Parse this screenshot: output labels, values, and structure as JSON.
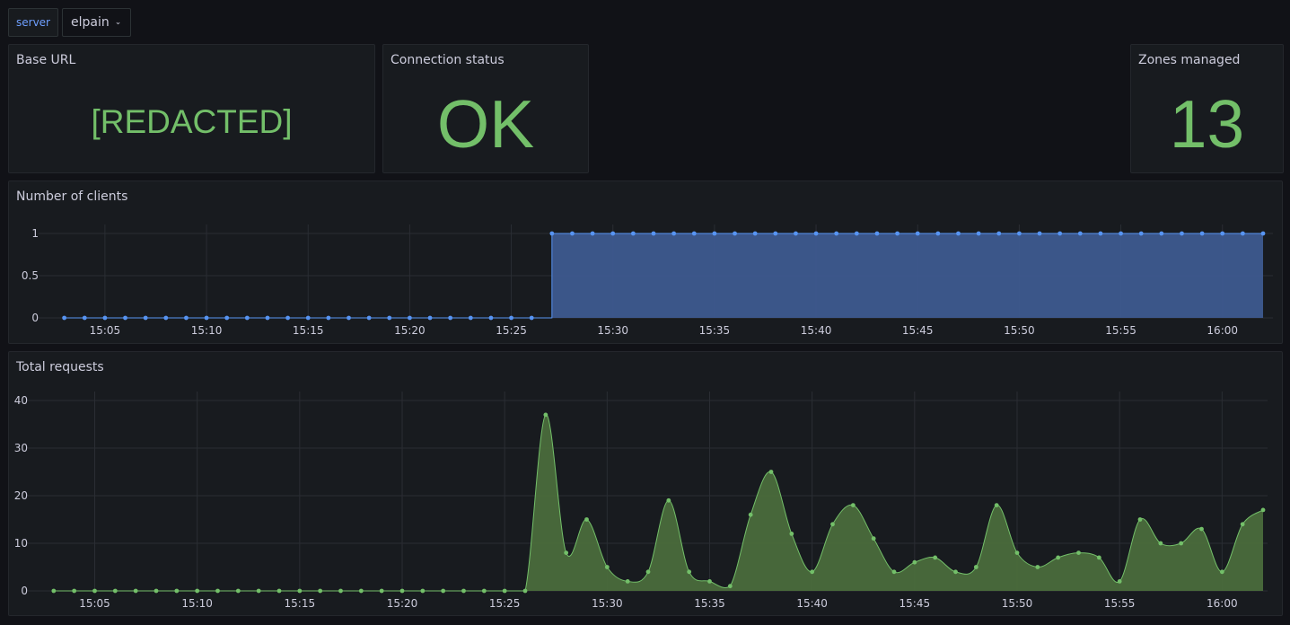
{
  "variables": {
    "label": "server",
    "selected": "elpain"
  },
  "panels": {
    "base_url": {
      "title": "Base URL",
      "value": "[REDACTED]"
    },
    "connection": {
      "title": "Connection status",
      "value": "OK"
    },
    "zones": {
      "title": "Zones managed",
      "value": "13"
    },
    "clients": {
      "title": "Number of clients"
    },
    "requests": {
      "title": "Total requests"
    }
  },
  "colors": {
    "stat_green": "#73bf69",
    "clients_line": "#5794f2",
    "clients_fill": "#3d5a8f",
    "requests_line": "#73bf69",
    "requests_fill": "#4a6b3c"
  },
  "chart_data": [
    {
      "type": "area",
      "title": "Number of clients",
      "x_range": [
        "15:02",
        "16:02"
      ],
      "x_ticks": [
        "15:05",
        "15:10",
        "15:15",
        "15:20",
        "15:25",
        "15:30",
        "15:35",
        "15:40",
        "15:45",
        "15:50",
        "15:55",
        "16:00"
      ],
      "y_ticks": [
        "0",
        "0.5",
        "1"
      ],
      "ylim": [
        0,
        1
      ],
      "interpolation": "step",
      "x": [
        "15:03",
        "15:04",
        "15:05",
        "15:06",
        "15:07",
        "15:08",
        "15:09",
        "15:10",
        "15:11",
        "15:12",
        "15:13",
        "15:14",
        "15:15",
        "15:16",
        "15:17",
        "15:18",
        "15:19",
        "15:20",
        "15:21",
        "15:22",
        "15:23",
        "15:24",
        "15:25",
        "15:26",
        "15:27",
        "15:28",
        "15:29",
        "15:30",
        "15:31",
        "15:32",
        "15:33",
        "15:34",
        "15:35",
        "15:36",
        "15:37",
        "15:38",
        "15:39",
        "15:40",
        "15:41",
        "15:42",
        "15:43",
        "15:44",
        "15:45",
        "15:46",
        "15:47",
        "15:48",
        "15:49",
        "15:50",
        "15:51",
        "15:52",
        "15:53",
        "15:54",
        "15:55",
        "15:56",
        "15:57",
        "15:58",
        "15:59",
        "16:00",
        "16:01",
        "16:02"
      ],
      "values": [
        0,
        0,
        0,
        0,
        0,
        0,
        0,
        0,
        0,
        0,
        0,
        0,
        0,
        0,
        0,
        0,
        0,
        0,
        0,
        0,
        0,
        0,
        0,
        0,
        1,
        1,
        1,
        1,
        1,
        1,
        1,
        1,
        1,
        1,
        1,
        1,
        1,
        1,
        1,
        1,
        1,
        1,
        1,
        1,
        1,
        1,
        1,
        1,
        1,
        1,
        1,
        1,
        1,
        1,
        1,
        1,
        1,
        1,
        1,
        1
      ],
      "grid": true,
      "legend": "none"
    },
    {
      "type": "area",
      "title": "Total requests",
      "x_range": [
        "15:02",
        "16:02"
      ],
      "x_ticks": [
        "15:05",
        "15:10",
        "15:15",
        "15:20",
        "15:25",
        "15:30",
        "15:35",
        "15:40",
        "15:45",
        "15:50",
        "15:55",
        "16:00"
      ],
      "y_ticks": [
        "0",
        "10",
        "20",
        "30",
        "40"
      ],
      "ylim": [
        0,
        40
      ],
      "interpolation": "smooth",
      "x": [
        "15:03",
        "15:04",
        "15:05",
        "15:06",
        "15:07",
        "15:08",
        "15:09",
        "15:10",
        "15:11",
        "15:12",
        "15:13",
        "15:14",
        "15:15",
        "15:16",
        "15:17",
        "15:18",
        "15:19",
        "15:20",
        "15:21",
        "15:22",
        "15:23",
        "15:24",
        "15:25",
        "15:26",
        "15:27",
        "15:28",
        "15:29",
        "15:30",
        "15:31",
        "15:32",
        "15:33",
        "15:34",
        "15:35",
        "15:36",
        "15:37",
        "15:38",
        "15:39",
        "15:40",
        "15:41",
        "15:42",
        "15:43",
        "15:44",
        "15:45",
        "15:46",
        "15:47",
        "15:48",
        "15:49",
        "15:50",
        "15:51",
        "15:52",
        "15:53",
        "15:54",
        "15:55",
        "15:56",
        "15:57",
        "15:58",
        "15:59",
        "16:00",
        "16:01",
        "16:02"
      ],
      "values": [
        0,
        0,
        0,
        0,
        0,
        0,
        0,
        0,
        0,
        0,
        0,
        0,
        0,
        0,
        0,
        0,
        0,
        0,
        0,
        0,
        0,
        0,
        0,
        0,
        37,
        8,
        15,
        5,
        2,
        4,
        19,
        4,
        2,
        1,
        16,
        25,
        12,
        4,
        14,
        18,
        11,
        4,
        6,
        7,
        4,
        5,
        18,
        8,
        5,
        7,
        8,
        7,
        2,
        15,
        10,
        10,
        13,
        4,
        14,
        17
      ],
      "grid": true,
      "legend": "none"
    }
  ]
}
